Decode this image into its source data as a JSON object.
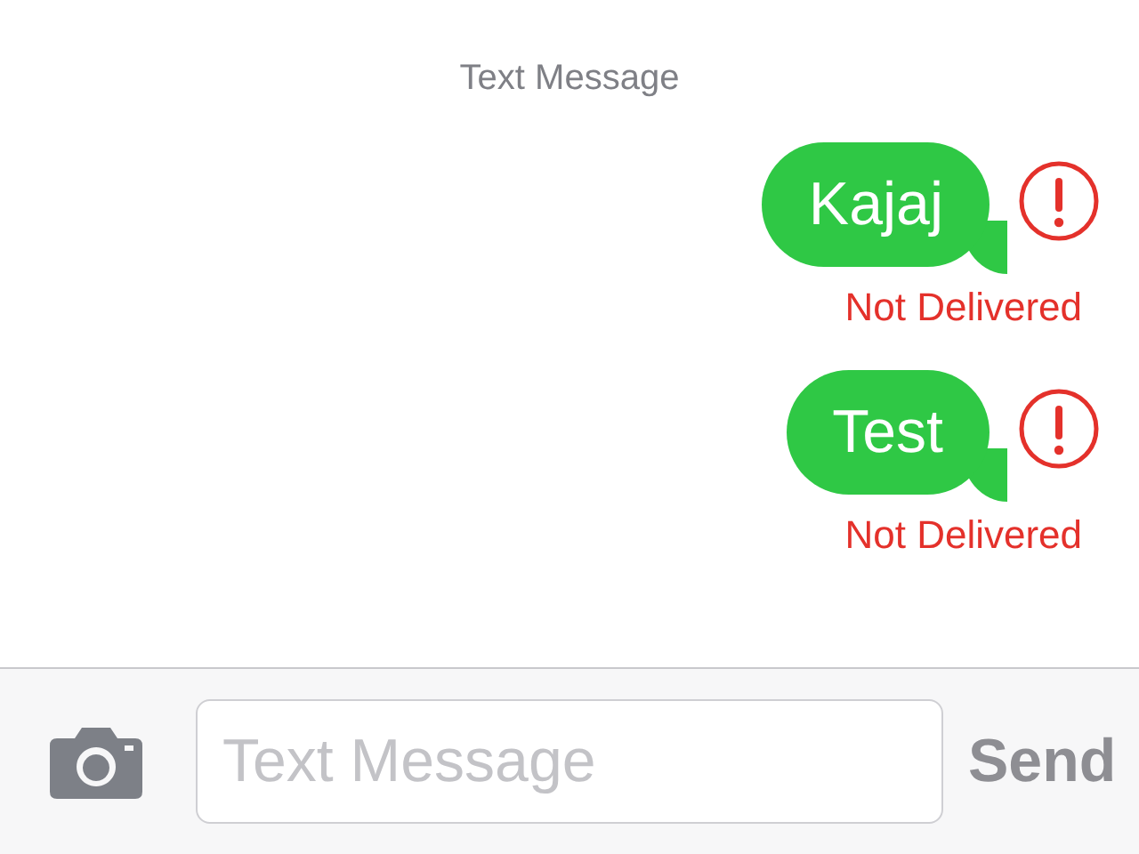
{
  "header": {
    "title": "Text Message"
  },
  "messages": [
    {
      "text": "Kajaj",
      "failed": true,
      "status": "Not Delivered"
    },
    {
      "text": "Test",
      "failed": true,
      "status": "Not Delivered"
    }
  ],
  "composer": {
    "placeholder": "Text Message",
    "send_button": {
      "label": "Send",
      "disabled": true
    }
  }
}
